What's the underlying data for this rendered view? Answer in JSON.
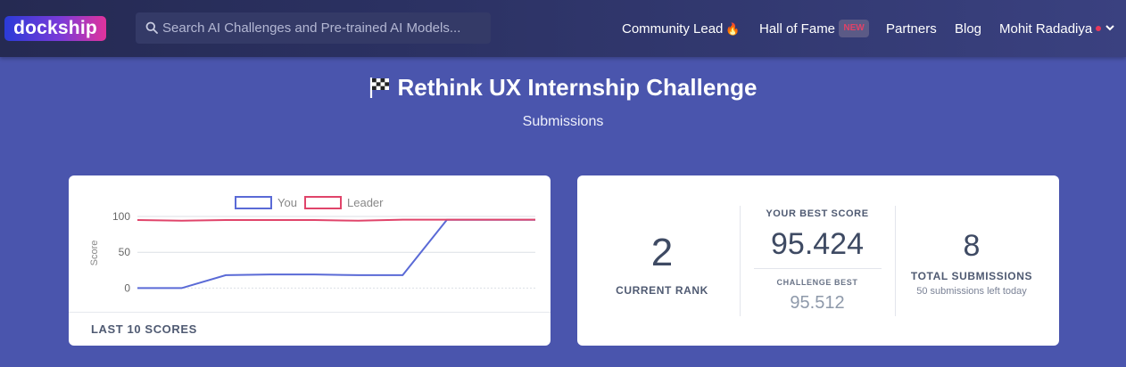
{
  "navbar": {
    "logo_text": "dockship",
    "search": {
      "placeholder": "Search AI Challenges and Pre-trained AI Models..."
    },
    "links": {
      "community_lead": "Community Lead",
      "community_lead_icon": "fire-icon",
      "hall_of_fame": "Hall of Fame",
      "hall_of_fame_badge": "NEW",
      "partners": "Partners",
      "blog": "Blog",
      "user_name": "Mohit Radadiya"
    }
  },
  "page": {
    "title": "Rethink UX Internship Challenge",
    "title_icon": "checkered-flag-icon",
    "subtitle": "Submissions"
  },
  "chart_card": {
    "footer_label": "LAST 10 SCORES"
  },
  "chart_data": {
    "type": "line",
    "x": [
      1,
      2,
      3,
      4,
      5,
      6,
      7,
      8,
      9,
      10
    ],
    "series": [
      {
        "name": "You",
        "values": [
          0,
          0,
          18,
          19,
          19,
          18,
          18,
          95.4,
          95.4,
          95.4
        ],
        "color": "#5a6ad6"
      },
      {
        "name": "Leader",
        "values": [
          95,
          94,
          95,
          95,
          95,
          94,
          95.5,
          95.5,
          95.5,
          95.5
        ],
        "color": "#e0446a"
      }
    ],
    "ylabel": "Score",
    "yticks": [
      0,
      50,
      100
    ],
    "ylim": [
      -2,
      100
    ],
    "grid": true,
    "legend": "top-center"
  },
  "stats": {
    "current_rank": {
      "value": "2",
      "label": "CURRENT RANK"
    },
    "best_score": {
      "label": "YOUR BEST SCORE",
      "value": "95.424"
    },
    "challenge_best": {
      "label": "CHALLENGE BEST",
      "value": "95.512"
    },
    "total_submissions": {
      "value": "8",
      "label": "TOTAL SUBMISSIONS",
      "note": "50 submissions left today"
    }
  },
  "colors": {
    "page_bg": "#4a55ad",
    "navbar_bg": "#2b3162",
    "you_line": "#5a6ad6",
    "leader_line": "#e0446a",
    "badge_text": "#e04268"
  }
}
